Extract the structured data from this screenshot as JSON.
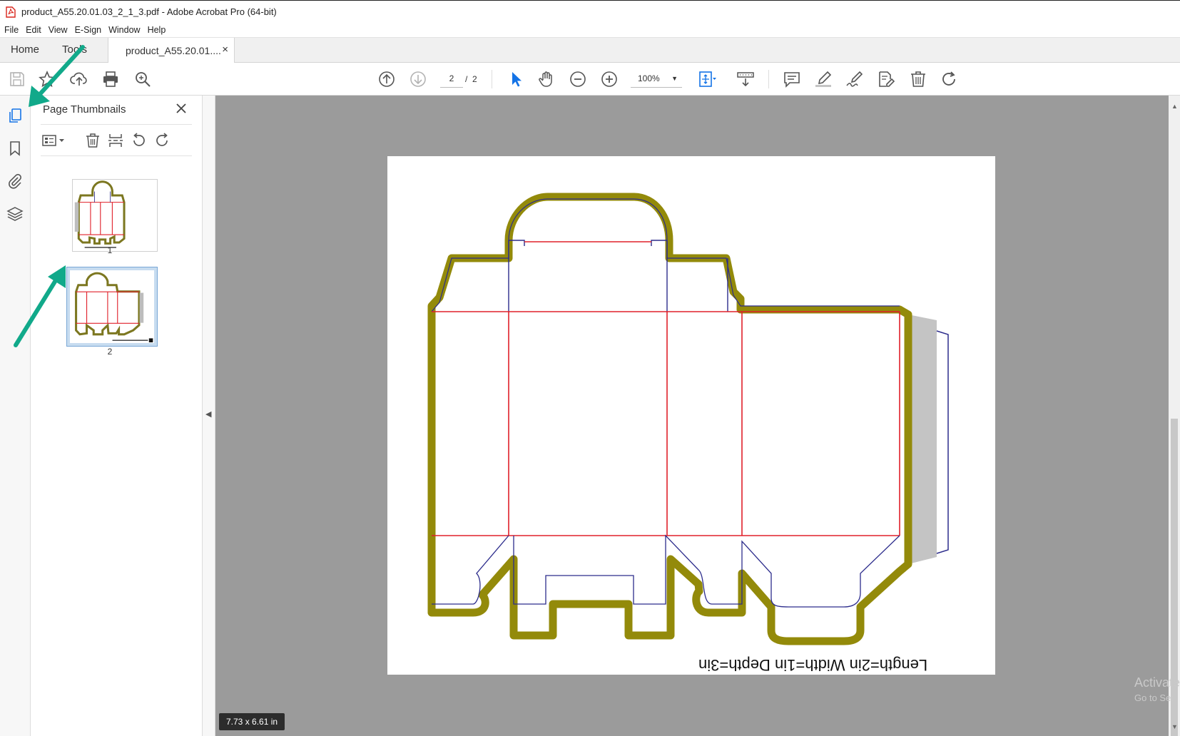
{
  "window": {
    "title": "product_A55.20.01.03_2_1_3.pdf - Adobe Acrobat Pro (64-bit)"
  },
  "menu": [
    "File",
    "Edit",
    "View",
    "E-Sign",
    "Window",
    "Help"
  ],
  "tabs": {
    "home": "Home",
    "tools": "Tools",
    "document": "product_A55.20.01....",
    "close_glyph": "×"
  },
  "toolbar": {
    "current_page": "2",
    "page_separator": "/",
    "total_pages": "2",
    "zoom": "100%",
    "icons": [
      "save-icon",
      "star-icon",
      "upload-icon",
      "print-icon",
      "find-icon",
      "page-up-icon",
      "page-down-icon",
      "select-arrow-icon",
      "hand-icon",
      "zoom-out-icon",
      "zoom-in-icon",
      "fit-page-icon",
      "scroll-mode-icon",
      "comment-icon",
      "highlight-icon",
      "sign-icon",
      "edit-pdf-icon",
      "delete-icon",
      "rotate-icon"
    ]
  },
  "sidebar": {
    "icons": [
      "page-thumbnails-icon",
      "bookmark-icon",
      "attachment-icon",
      "layers-icon"
    ]
  },
  "thumbnails_panel": {
    "title": "Page Thumbnails",
    "pages": [
      {
        "number": "1",
        "selected": false
      },
      {
        "number": "2",
        "selected": true
      }
    ]
  },
  "document": {
    "caption": "Length=2in Width=1in Depth=3in",
    "page_size": "7.73 x 6.61 in"
  },
  "watermark": {
    "line1": "Activate",
    "line2": "Go to Set"
  },
  "colors": {
    "accent": "#1473e6",
    "annotation_arrow": "#11a98a",
    "outline": "#938a0a",
    "cut_line": "#2c2c8c",
    "fold_line": "#e0202a",
    "flap": "#c4c4c4"
  }
}
